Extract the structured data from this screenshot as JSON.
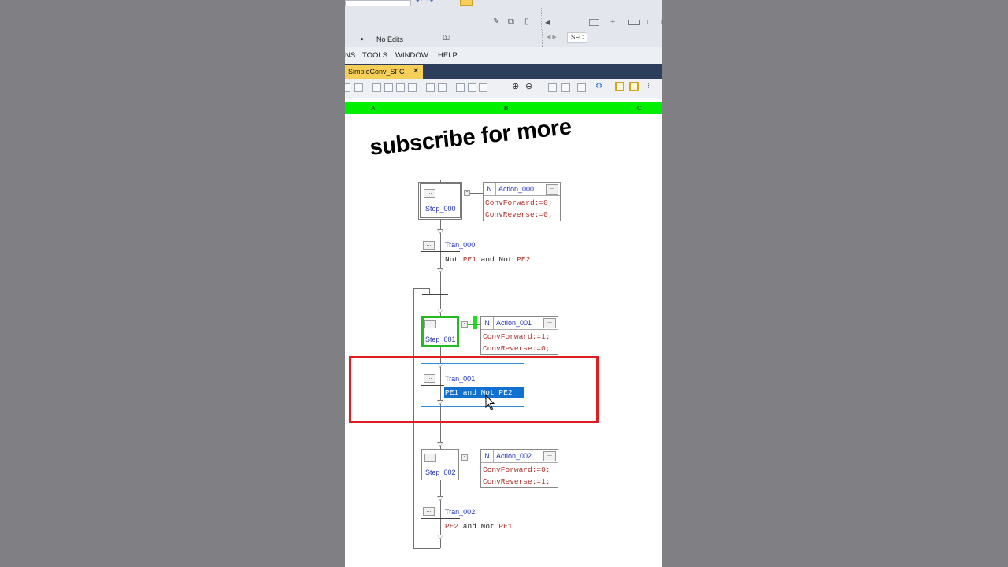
{
  "toolbar": {
    "edit_status": "No Edits",
    "sfc_label": "SFC"
  },
  "menu": {
    "items": [
      "NS",
      "TOOLS",
      "WINDOW",
      "HELP"
    ]
  },
  "tab": {
    "title": "SimpleConv_SFC",
    "close": "✕"
  },
  "ruler": {
    "columns": [
      "A",
      "B",
      "C"
    ]
  },
  "overlay": {
    "subscribe_text": "subscribe for more"
  },
  "sfc": {
    "steps": [
      {
        "name": "Step_000",
        "action_qualifier": "N",
        "action_name": "Action_000",
        "line1": "ConvForward:=0;",
        "line2": "ConvReverse:=0;"
      },
      {
        "name": "Step_001",
        "action_qualifier": "N",
        "action_name": "Action_001",
        "line1": "ConvForward:=1;",
        "line2": "ConvReverse:=0;"
      },
      {
        "name": "Step_002",
        "action_qualifier": "N",
        "action_name": "Action_002",
        "line1": "ConvForward:=0;",
        "line2": "ConvReverse:=1;"
      }
    ],
    "transitions": [
      {
        "name": "Tran_000",
        "cond_a": "Not ",
        "var_a": "PE1",
        "cond_b": " and Not ",
        "var_b": "PE2"
      },
      {
        "name": "Tran_001",
        "selected_condition": "PE1 and Not PE2"
      },
      {
        "name": "Tran_002",
        "var_a": "PE2",
        "cond_b": " and Not ",
        "var_b": "PE1"
      }
    ],
    "dots_label": "...",
    "tag_label": "-"
  },
  "colors": {
    "active_step": "#22bb22",
    "selection": "#1170d0",
    "highlight_rect": "#dd1f24",
    "ruler": "#00ee00"
  }
}
